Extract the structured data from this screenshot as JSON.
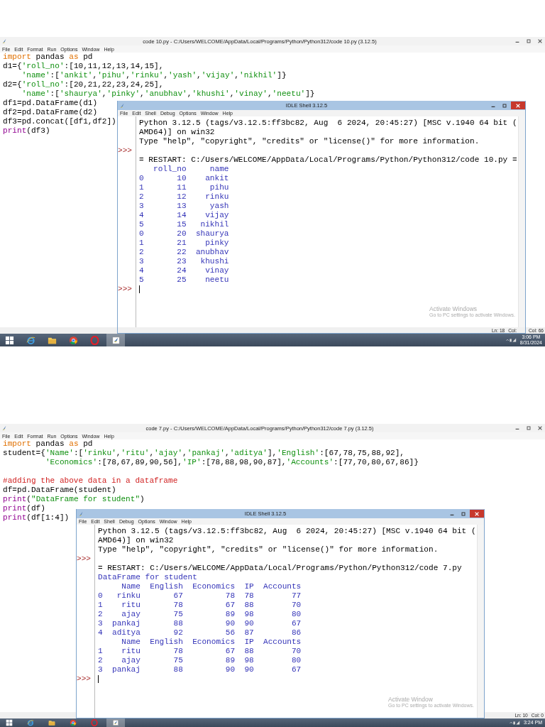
{
  "screenshots": [
    {
      "editor": {
        "title": "code 10.py - C:/Users/WELCOME/AppData/Local/Programs/Python/Python312/code 10.py (3.12.5)",
        "menu": [
          "File",
          "Edit",
          "Format",
          "Run",
          "Options",
          "Window",
          "Help"
        ],
        "code": [
          {
            "kind": "code",
            "tokens": [
              {
                "kind": "keyword",
                "t": "import"
              },
              {
                "kind": "plain",
                "t": " pandas "
              },
              {
                "kind": "keyword",
                "t": "as"
              },
              {
                "kind": "plain",
                "t": " pd"
              }
            ]
          },
          {
            "kind": "code",
            "tokens": [
              {
                "kind": "plain",
                "t": "d1={"
              },
              {
                "kind": "string",
                "t": "'roll_no'"
              },
              {
                "kind": "plain",
                "t": ":[10,11,12,13,14,15],"
              }
            ]
          },
          {
            "kind": "code",
            "tokens": [
              {
                "kind": "string",
                "t": "    'name'"
              },
              {
                "kind": "plain",
                "t": ":["
              },
              {
                "kind": "string",
                "t": "'ankit'"
              },
              {
                "kind": "plain",
                "t": ","
              },
              {
                "kind": "string",
                "t": "'pihu'"
              },
              {
                "kind": "plain",
                "t": ","
              },
              {
                "kind": "string",
                "t": "'rinku'"
              },
              {
                "kind": "plain",
                "t": ","
              },
              {
                "kind": "string",
                "t": "'yash'"
              },
              {
                "kind": "plain",
                "t": ","
              },
              {
                "kind": "string",
                "t": "'vijay'"
              },
              {
                "kind": "plain",
                "t": ","
              },
              {
                "kind": "string",
                "t": "'nikhil'"
              },
              {
                "kind": "plain",
                "t": "]}"
              }
            ]
          },
          {
            "kind": "code",
            "tokens": [
              {
                "kind": "plain",
                "t": "d2={"
              },
              {
                "kind": "string",
                "t": "'roll_no'"
              },
              {
                "kind": "plain",
                "t": ":[20,21,22,23,24,25],"
              }
            ]
          },
          {
            "kind": "code",
            "tokens": [
              {
                "kind": "string",
                "t": "    'name'"
              },
              {
                "kind": "plain",
                "t": ":["
              },
              {
                "kind": "string",
                "t": "'shaurya'"
              },
              {
                "kind": "plain",
                "t": ","
              },
              {
                "kind": "string",
                "t": "'pinky'"
              },
              {
                "kind": "plain",
                "t": ","
              },
              {
                "kind": "string",
                "t": "'anubhav'"
              },
              {
                "kind": "plain",
                "t": ","
              },
              {
                "kind": "string",
                "t": "'khushi'"
              },
              {
                "kind": "plain",
                "t": ","
              },
              {
                "kind": "string",
                "t": "'vinay'"
              },
              {
                "kind": "plain",
                "t": ","
              },
              {
                "kind": "string",
                "t": "'neetu'"
              },
              {
                "kind": "plain",
                "t": "]}"
              }
            ]
          },
          {
            "kind": "code",
            "tokens": [
              {
                "kind": "plain",
                "t": "df1=pd.DataFrame(d1)"
              }
            ]
          },
          {
            "kind": "code",
            "tokens": [
              {
                "kind": "plain",
                "t": "df2=pd.DataFrame(d2)"
              }
            ]
          },
          {
            "kind": "code",
            "tokens": [
              {
                "kind": "plain",
                "t": "df3=pd.concat([df1,df2])"
              }
            ]
          },
          {
            "kind": "code",
            "tokens": [
              {
                "kind": "builtin",
                "t": "print"
              },
              {
                "kind": "plain",
                "t": "(df3)"
              }
            ]
          }
        ],
        "status": [
          "Col: 66"
        ]
      },
      "shell": {
        "title": "IDLE Shell 3.12.5",
        "menu": [
          "File",
          "Edit",
          "Shell",
          "Debug",
          "Options",
          "Window",
          "Help"
        ],
        "lines": [
          {
            "kind": "text",
            "text": "Python 3.12.5 (tags/v3.12.5:ff3bc82, Aug  6 2024, 20:45:27) [MSC v.1940 64 bit ("
          },
          {
            "kind": "text",
            "text": "AMD64)] on win32"
          },
          {
            "kind": "text",
            "text": "Type \"help\", \"copyright\", \"credits\" or \"license()\" for more information."
          },
          {
            "kind": "prompt",
            "prompt": ">>>"
          },
          {
            "kind": "text",
            "text": "= RESTART: C:/Users/WELCOME/AppData/Local/Programs/Python/Python312/code 10.py ="
          },
          {
            "kind": "output",
            "text": "   roll_no     name"
          },
          {
            "kind": "output",
            "text": "0       10    ankit"
          },
          {
            "kind": "output",
            "text": "1       11     pihu"
          },
          {
            "kind": "output",
            "text": "2       12    rinku"
          },
          {
            "kind": "output",
            "text": "3       13     yash"
          },
          {
            "kind": "output",
            "text": "4       14    vijay"
          },
          {
            "kind": "output",
            "text": "5       15   nikhil"
          },
          {
            "kind": "output",
            "text": "0       20  shaurya"
          },
          {
            "kind": "output",
            "text": "1       21    pinky"
          },
          {
            "kind": "output",
            "text": "2       22  anubhav"
          },
          {
            "kind": "output",
            "text": "3       23   khushi"
          },
          {
            "kind": "output",
            "text": "4       24    vinay"
          },
          {
            "kind": "output",
            "text": "5       25    neetu"
          },
          {
            "kind": "prompt",
            "prompt": ">>>",
            "cursor": true
          }
        ],
        "status": [
          "Ln: 18",
          "Col:"
        ],
        "watermark": {
          "title": "Activate Windows",
          "subtitle": "Go to PC settings to activate Windows."
        }
      },
      "taskbar": {
        "apps": [
          {
            "kind": "start",
            "selected": false
          },
          {
            "kind": "ie",
            "selected": false
          },
          {
            "kind": "folder",
            "selected": false
          },
          {
            "kind": "chrome",
            "selected": false
          },
          {
            "kind": "opera",
            "selected": false
          },
          {
            "kind": "idle",
            "selected": true
          }
        ],
        "time": "3:06 PM",
        "date": "8/31/2024"
      }
    },
    {
      "editor": {
        "title": "code 7.py - C:/Users/WELCOME/AppData/Local/Programs/Python/Python312/code 7.py (3.12.5)",
        "menu": [
          "File",
          "Edit",
          "Format",
          "Run",
          "Options",
          "Window",
          "Help"
        ],
        "code": [
          {
            "kind": "code",
            "tokens": [
              {
                "kind": "keyword",
                "t": "import"
              },
              {
                "kind": "plain",
                "t": " pandas "
              },
              {
                "kind": "keyword",
                "t": "as"
              },
              {
                "kind": "plain",
                "t": " pd"
              }
            ]
          },
          {
            "kind": "code",
            "tokens": [
              {
                "kind": "plain",
                "t": "student={"
              },
              {
                "kind": "string",
                "t": "'Name'"
              },
              {
                "kind": "plain",
                "t": ":["
              },
              {
                "kind": "string",
                "t": "'rinku'"
              },
              {
                "kind": "plain",
                "t": ","
              },
              {
                "kind": "string",
                "t": "'ritu'"
              },
              {
                "kind": "plain",
                "t": ","
              },
              {
                "kind": "string",
                "t": "'ajay'"
              },
              {
                "kind": "plain",
                "t": ","
              },
              {
                "kind": "string",
                "t": "'pankaj'"
              },
              {
                "kind": "plain",
                "t": ","
              },
              {
                "kind": "string",
                "t": "'aditya'"
              },
              {
                "kind": "plain",
                "t": "],"
              },
              {
                "kind": "string",
                "t": "'English'"
              },
              {
                "kind": "plain",
                "t": ":[67,78,75,88,92],"
              }
            ]
          },
          {
            "kind": "code",
            "tokens": [
              {
                "kind": "string",
                "t": "         'Economics'"
              },
              {
                "kind": "plain",
                "t": ":[78,67,89,90,56],"
              },
              {
                "kind": "string",
                "t": "'IP'"
              },
              {
                "kind": "plain",
                "t": ":[78,88,98,90,87],"
              },
              {
                "kind": "string",
                "t": "'Accounts'"
              },
              {
                "kind": "plain",
                "t": ":[77,70,80,67,86]}"
              }
            ]
          },
          {
            "kind": "blank"
          },
          {
            "kind": "code",
            "tokens": [
              {
                "kind": "comment",
                "t": "#adding the above data in a dataframe"
              }
            ]
          },
          {
            "kind": "code",
            "tokens": [
              {
                "kind": "plain",
                "t": "df=pd.DataFrame(student)"
              }
            ]
          },
          {
            "kind": "code",
            "tokens": [
              {
                "kind": "builtin",
                "t": "print"
              },
              {
                "kind": "plain",
                "t": "("
              },
              {
                "kind": "string",
                "t": "\"DataFrame for student\""
              },
              {
                "kind": "plain",
                "t": ")"
              }
            ]
          },
          {
            "kind": "code",
            "tokens": [
              {
                "kind": "builtin",
                "t": "print"
              },
              {
                "kind": "plain",
                "t": "(df)"
              }
            ]
          },
          {
            "kind": "code",
            "tokens": [
              {
                "kind": "builtin",
                "t": "print"
              },
              {
                "kind": "plain",
                "t": "(df[1:4])"
              }
            ]
          }
        ],
        "status": [
          "Ln: 10",
          "Col: 0"
        ]
      },
      "shell": {
        "title": "IDLE Shell 3.12.5",
        "menu": [
          "File",
          "Edit",
          "Shell",
          "Debug",
          "Options",
          "Window",
          "Help"
        ],
        "lines": [
          {
            "kind": "text",
            "text": "Python 3.12.5 (tags/v3.12.5:ff3bc82, Aug  6 2024, 20:45:27) [MSC v.1940 64 bit ("
          },
          {
            "kind": "text",
            "text": "AMD64)] on win32"
          },
          {
            "kind": "text",
            "text": "Type \"help\", \"copyright\", \"credits\" or \"license()\" for more information."
          },
          {
            "kind": "prompt",
            "prompt": ">>>"
          },
          {
            "kind": "text",
            "text": "= RESTART: C:/Users/WELCOME/AppData/Local/Programs/Python/Python312/code 7.py"
          },
          {
            "kind": "output",
            "text": "DataFrame for student"
          },
          {
            "kind": "output",
            "text": "     Name  English  Economics  IP  Accounts"
          },
          {
            "kind": "output",
            "text": "0   rinku       67         78  78        77"
          },
          {
            "kind": "output",
            "text": "1    ritu       78         67  88        70"
          },
          {
            "kind": "output",
            "text": "2    ajay       75         89  98        80"
          },
          {
            "kind": "output",
            "text": "3  pankaj       88         90  90        67"
          },
          {
            "kind": "output",
            "text": "4  aditya       92         56  87        86"
          },
          {
            "kind": "output",
            "text": "     Name  English  Economics  IP  Accounts"
          },
          {
            "kind": "output",
            "text": "1    ritu       78         67  88        70"
          },
          {
            "kind": "output",
            "text": "2    ajay       75         89  98        80"
          },
          {
            "kind": "output",
            "text": "3  pankaj       88         90  90        67"
          },
          {
            "kind": "prompt",
            "prompt": ">>>",
            "cursor": true
          }
        ],
        "watermark": {
          "title": "Activate Window",
          "subtitle": "Go to PC settings to activate Windows."
        }
      },
      "taskbar": {
        "apps": [
          {
            "kind": "start",
            "selected": false
          },
          {
            "kind": "ie",
            "selected": false
          },
          {
            "kind": "folder",
            "selected": false
          },
          {
            "kind": "chrome",
            "selected": false
          },
          {
            "kind": "opera",
            "selected": false
          },
          {
            "kind": "idle",
            "selected": true
          }
        ],
        "time": "3:24 PM"
      }
    }
  ]
}
